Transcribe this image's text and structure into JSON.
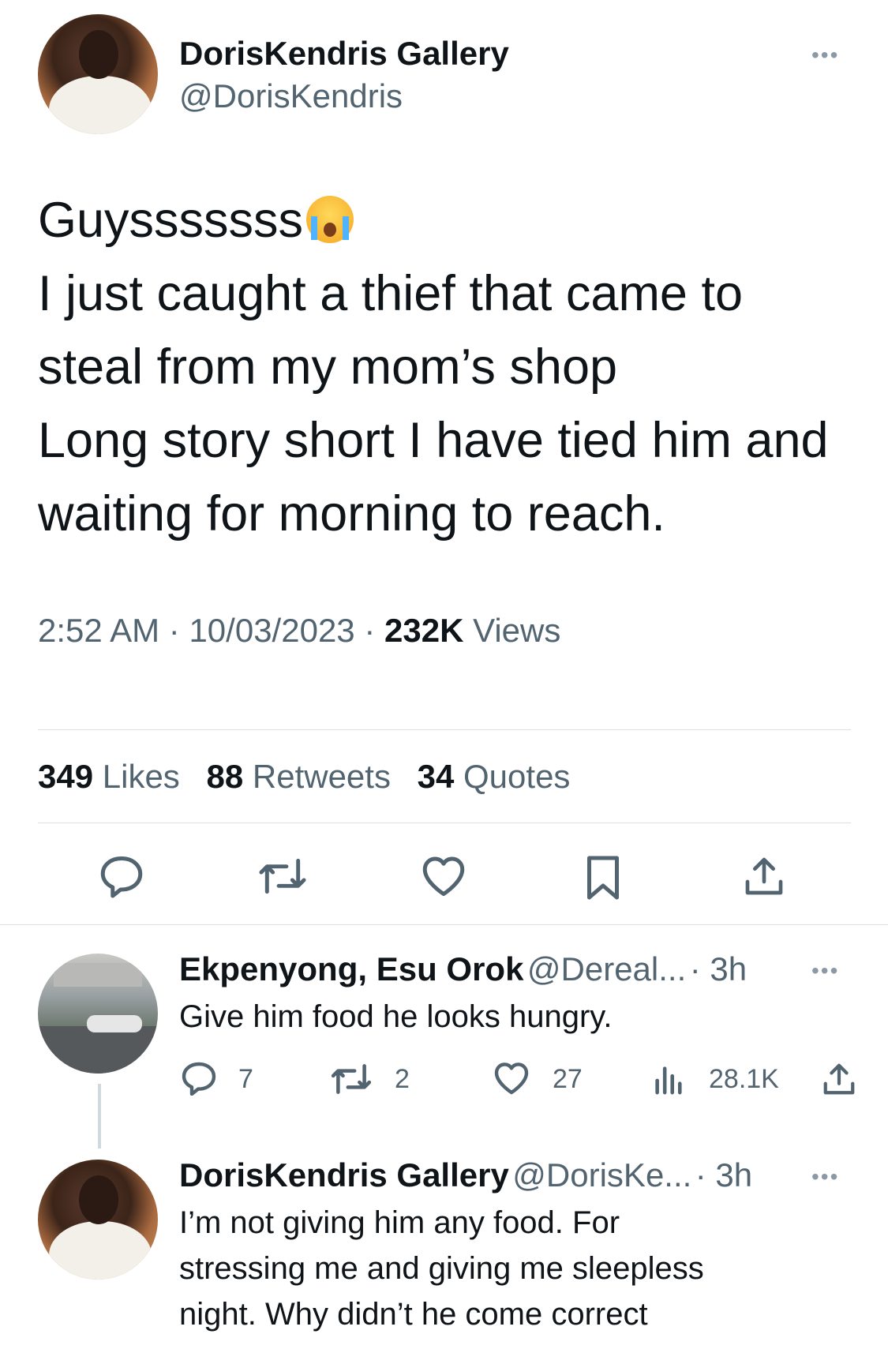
{
  "tweet": {
    "author_name": "DorisKendris Gallery",
    "author_handle": "@DorisKendris",
    "more_label": "•••",
    "text_line1": "Guysssssss",
    "emoji": "loudly-crying-face",
    "text_line2": "I just caught a thief that came to",
    "text_line3": "steal from my mom’s shop",
    "text_line4": "Long story short I have tied him and",
    "text_line5": "waiting for morning to reach.",
    "time": "2:52 AM",
    "date": "10/03/2023",
    "separator": "·",
    "views_count": "232K",
    "views_label": "Views",
    "likes_count": "349",
    "likes_label": "Likes",
    "retweets_count": "88",
    "retweets_label": "Retweets",
    "quotes_count": "34",
    "quotes_label": "Quotes"
  },
  "action_bar": [
    "reply-icon",
    "retweet-icon",
    "like-icon",
    "bookmark-icon",
    "share-icon"
  ],
  "replies": [
    {
      "author_name": "Ekpenyong, Esu Orok",
      "author_handle": "@Dereal...",
      "time": "· 3h",
      "text": "Give him food he looks hungry.",
      "reply_count": "7",
      "retweet_count": "2",
      "like_count": "27",
      "views_count": "28.1K"
    },
    {
      "author_name": "DorisKendris Gallery",
      "author_handle": "@DorisKe...",
      "time": "· 3h",
      "text_line1": "I’m not giving him any food. For",
      "text_line2": "stressing me and giving me sleepless",
      "text_line3": "night. Why didn’t he come correct"
    }
  ],
  "colors": {
    "text": "#0f1419",
    "secondary": "#536471",
    "divider": "#dcdfe3",
    "thread_line": "#cfd9de"
  }
}
